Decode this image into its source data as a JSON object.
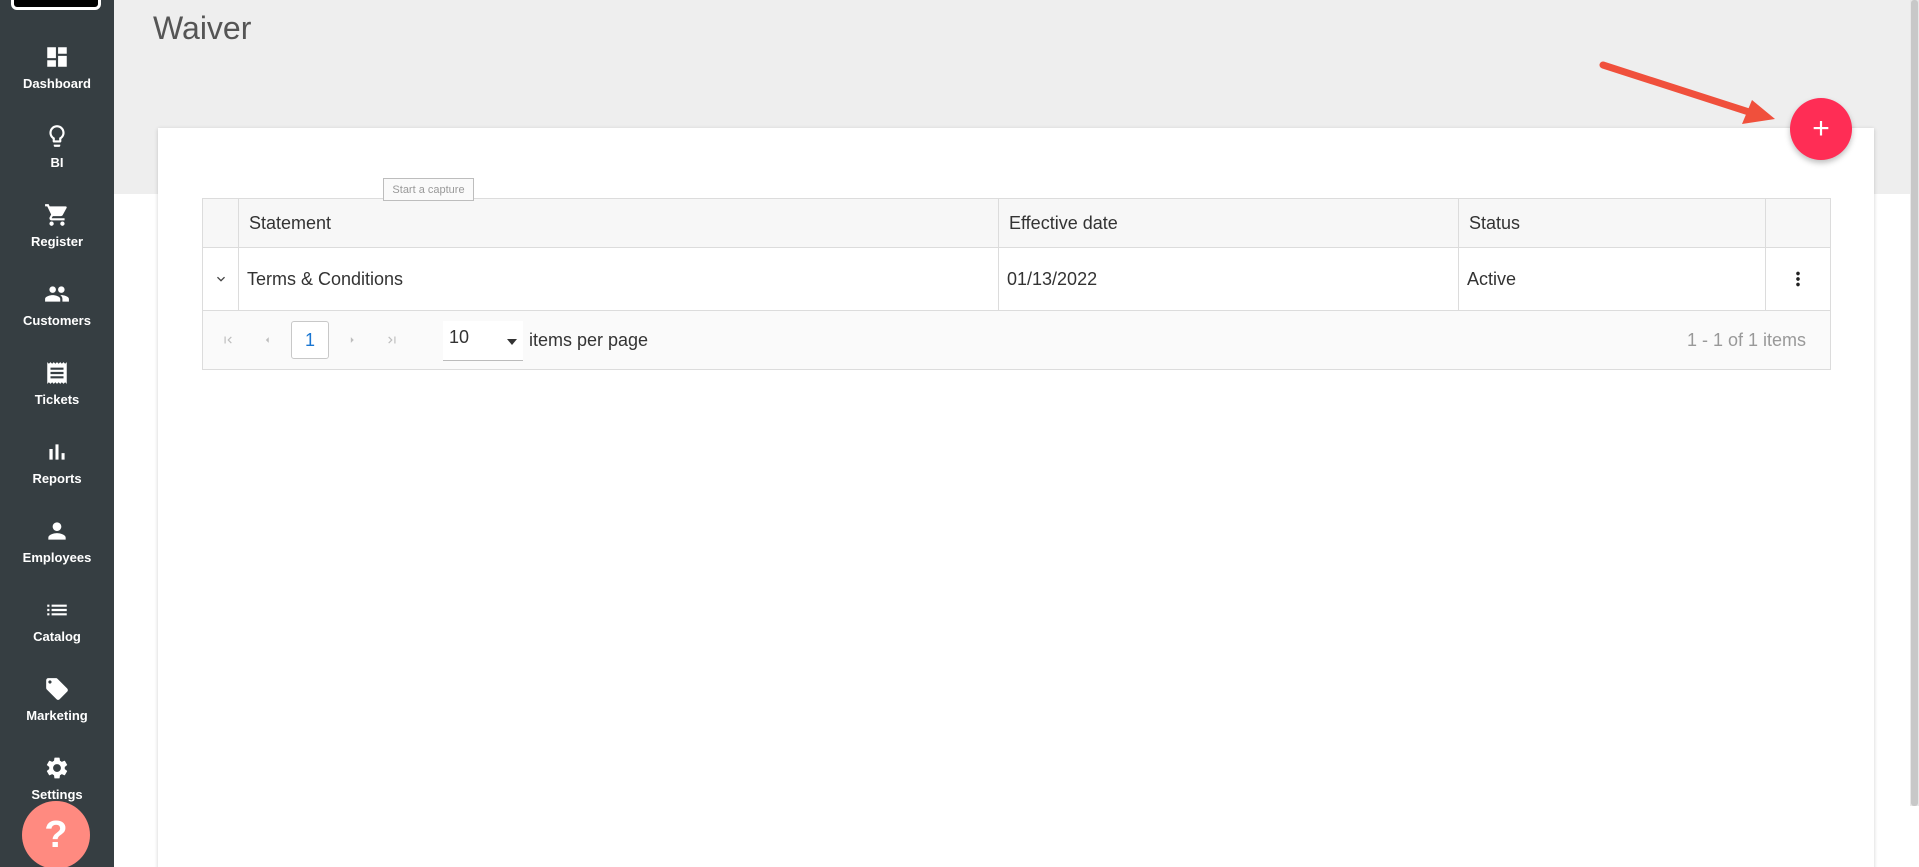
{
  "header": {
    "title": "Waiver"
  },
  "sidebar": {
    "items": [
      {
        "label": "Dashboard",
        "icon": "dashboard-icon"
      },
      {
        "label": "BI",
        "icon": "lightbulb-icon"
      },
      {
        "label": "Register",
        "icon": "cart-icon"
      },
      {
        "label": "Customers",
        "icon": "people-icon"
      },
      {
        "label": "Tickets",
        "icon": "receipt-icon"
      },
      {
        "label": "Reports",
        "icon": "bar-chart-icon"
      },
      {
        "label": "Employees",
        "icon": "person-icon"
      },
      {
        "label": "Catalog",
        "icon": "list-icon"
      },
      {
        "label": "Marketing",
        "icon": "tag-icon"
      },
      {
        "label": "Settings",
        "icon": "gear-icon"
      }
    ],
    "help_label": "?"
  },
  "tooltip": {
    "text": "Start a capture"
  },
  "fab": {
    "label": "+",
    "color": "#ff2d55"
  },
  "grid": {
    "columns": [
      "Statement",
      "Effective date",
      "Status"
    ],
    "rows": [
      {
        "statement": "Terms & Conditions",
        "effective_date": "01/13/2022",
        "status": "Active"
      }
    ],
    "pager": {
      "current_page": "1",
      "page_size": "10",
      "page_size_label": "items per page",
      "info": "1 - 1 of 1 items"
    }
  },
  "colors": {
    "sidebar": "#363e42",
    "accent": "#ff2d55",
    "help": "#ff8a80",
    "arrow": "#f0503c"
  }
}
